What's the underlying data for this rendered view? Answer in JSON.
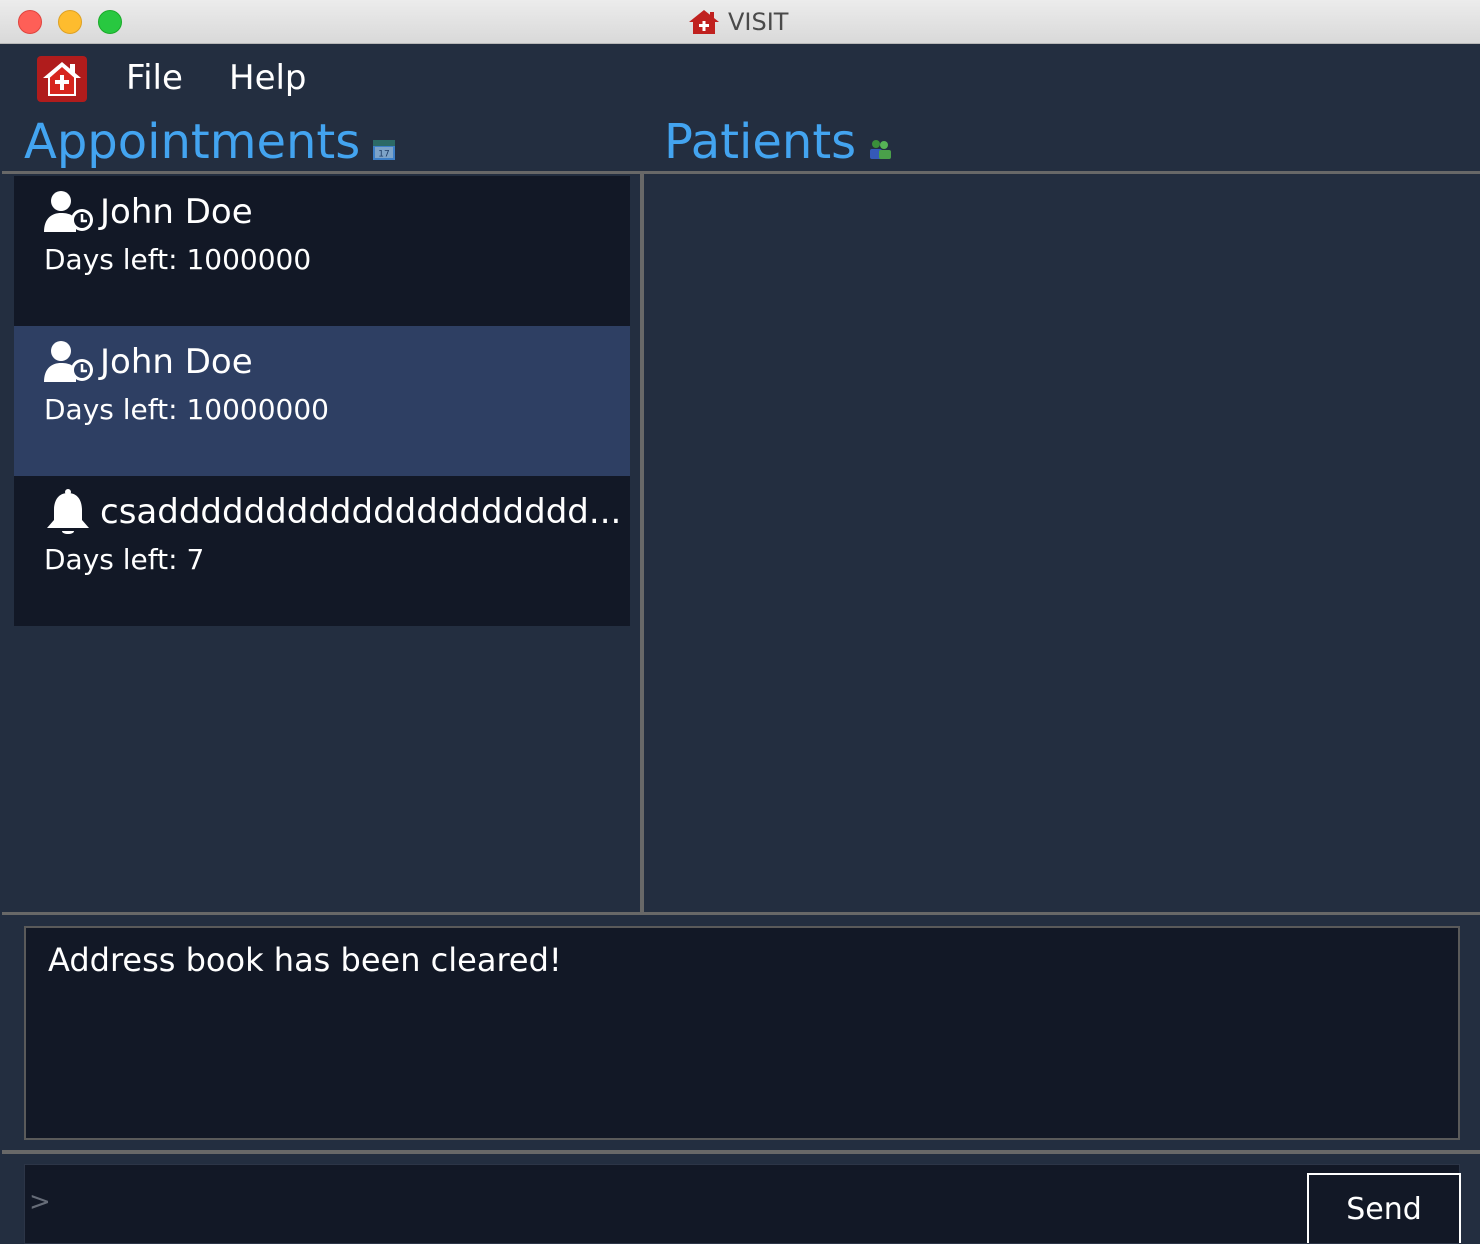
{
  "window": {
    "title": "VISIT",
    "title_icon": "house-icon"
  },
  "menu": {
    "app_icon": "house-icon",
    "items": [
      {
        "label": "File"
      },
      {
        "label": "Help"
      }
    ]
  },
  "appointments": {
    "header": "Appointments",
    "header_icon": "calendar-icon",
    "items": [
      {
        "name": "John Doe",
        "days_left": "Days left: 1000000",
        "icon": "user-clock-icon",
        "selected": false
      },
      {
        "name": "John Doe",
        "days_left": "Days left: 10000000",
        "icon": "user-clock-icon",
        "selected": true
      },
      {
        "name": "csadddddddddddddddddddd...",
        "days_left": "Days left: 7",
        "icon": "bell-icon",
        "selected": false
      }
    ]
  },
  "patients": {
    "header": "Patients",
    "header_icon": "users-icon",
    "items": []
  },
  "result": {
    "message": "Address book has been cleared!"
  },
  "command": {
    "prompt": ">",
    "value": "",
    "send_label": "Send"
  },
  "colors": {
    "background": "#232e40",
    "card": "#121826",
    "card_selected": "#2e3f63",
    "header_accent": "#43a4f0",
    "house_red": "#c0211f"
  }
}
